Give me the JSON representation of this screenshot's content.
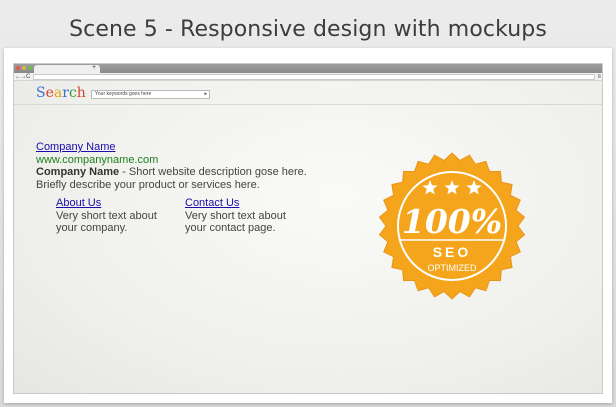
{
  "banner": {
    "title": "Scene 5 - Responsive design with mockups"
  },
  "browser": {
    "tab_new": "+",
    "nav_buttons": "←→C",
    "menu_icon": "≡",
    "window_dots": [
      "#e15b4f",
      "#e5b442",
      "#6bbf4c"
    ]
  },
  "search": {
    "logo_letters": [
      "S",
      "e",
      "a",
      "r",
      "c",
      "h"
    ],
    "placeholder": "Your keywords goes here",
    "dropdown_arrow": "▸"
  },
  "result": {
    "company_name": "Company Name",
    "url": "www.companyname.com",
    "desc_bold": "Company Name",
    "desc_line1": " - Short website description gose here.",
    "desc_line2": "Briefly describe your product or services here.",
    "sublinks": [
      {
        "title": "About Us",
        "line1": "Very short text about",
        "line2": "your company."
      },
      {
        "title": "Contact Us",
        "line1": "Very short text about",
        "line2": "your contact page."
      }
    ]
  },
  "badge": {
    "percent": "100%",
    "label": "SEO",
    "sublabel": "OPTIMIZED",
    "stars": 3,
    "fill_color": "#f4a51c",
    "edge_color": "#e8941a"
  }
}
